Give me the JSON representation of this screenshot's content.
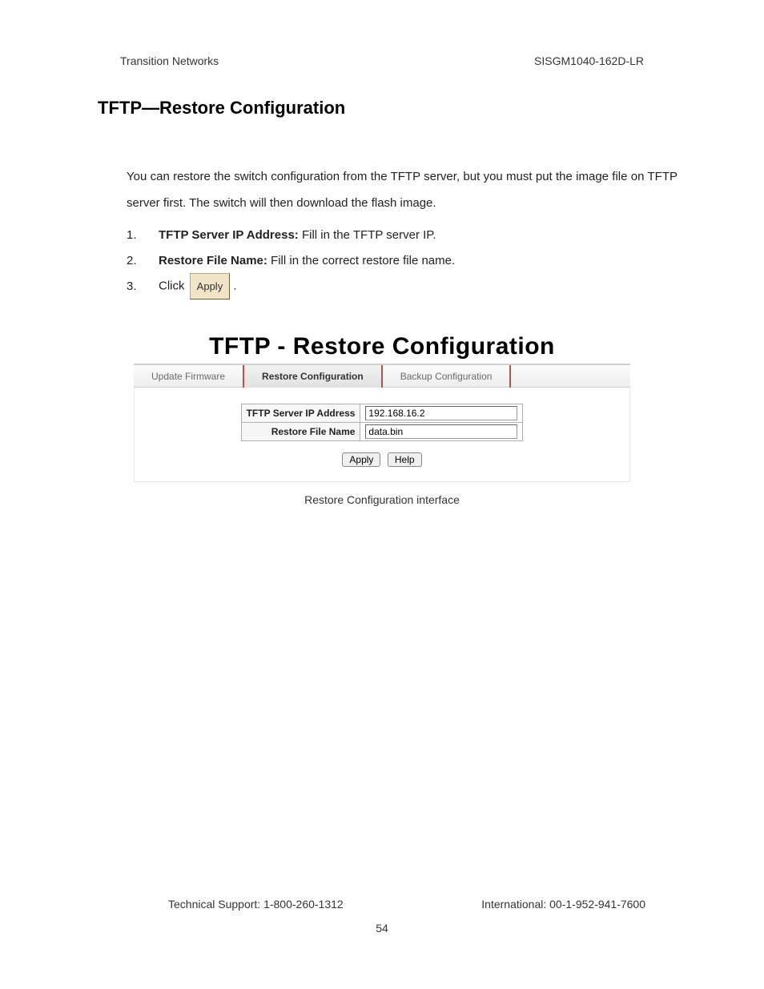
{
  "header": {
    "left": "Transition Networks",
    "right": "SISGM1040-162D-LR"
  },
  "title": "TFTP—Restore Configuration",
  "intro": "You can restore the switch configuration from the TFTP server, but you must put the image file on TFTP server first.   The switch will then download the flash image.",
  "steps": {
    "n1": "1.",
    "s1_bold": "TFTP Server IP Address:",
    "s1_rest": " Fill in the TFTP server IP.",
    "n2": "2.",
    "s2_bold": "Restore File Name:",
    "s2_rest": " Fill in the correct restore file name.",
    "n3": "3.",
    "s3_pre": "Click ",
    "s3_btn": "Apply",
    "s3_post": " ."
  },
  "screenshot": {
    "heading": "TFTP - Restore Configuration",
    "tabs": {
      "t1": "Update Firmware",
      "t2": "Restore Configuration",
      "t3": "Backup Configuration"
    },
    "form": {
      "row1_label": "TFTP Server IP Address",
      "row1_value": "192.168.16.2",
      "row2_label": "Restore File Name",
      "row2_value": "data.bin"
    },
    "buttons": {
      "apply": "Apply",
      "help": "Help"
    },
    "caption": "Restore Configuration interface"
  },
  "footer": {
    "left": "Technical Support: 1-800-260-1312",
    "right": "International: 00-1-952-941-7600",
    "page": "54"
  }
}
